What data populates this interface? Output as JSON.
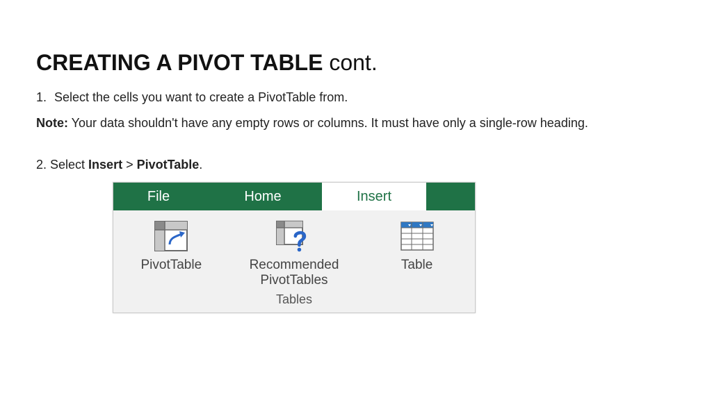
{
  "title": {
    "bold": "CREATING A PIVOT TABLE",
    "rest": " cont."
  },
  "step1": {
    "num": "1.",
    "text": "Select the cells you want to create a PivotTable from."
  },
  "note": {
    "label": "Note:",
    "text": "  Your data shouldn't have any empty rows or columns. It must have only a single-row heading."
  },
  "step2": {
    "prefix": "2. Select ",
    "b1": "Insert",
    "sep": " > ",
    "b2": "PivotTable",
    "suffix": "."
  },
  "ribbon": {
    "tabs": {
      "file": "File",
      "home": "Home",
      "insert": "Insert"
    },
    "tools": {
      "pivottable": "PivotTable",
      "recommended_l1": "Recommended",
      "recommended_l2": "PivotTables",
      "table": "Table"
    },
    "group": "Tables"
  }
}
